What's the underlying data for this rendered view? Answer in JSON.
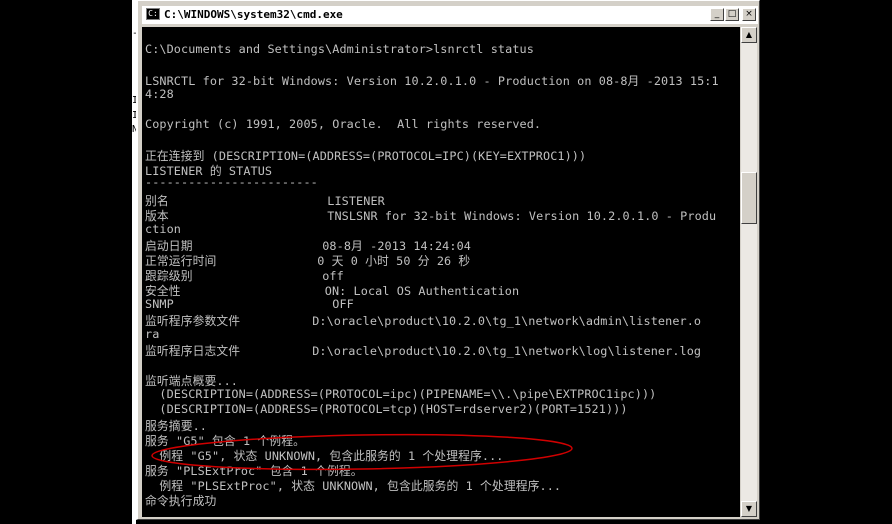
{
  "window": {
    "title": "C:\\WINDOWS\\system32\\cmd.exe",
    "controls": {
      "minimize": "_",
      "maximize": "□",
      "close": "×"
    }
  },
  "console": {
    "lines": [
      {
        "text": "C:\\Documents and Settings\\Administrator>lsnrctl status"
      },
      {
        "text": "LSNRCTL for 32-bit Windows: Version 10.2.0.1.0 - Production on 08-8月 -2013 15:1"
      },
      {
        "text": "4:28"
      },
      {
        "text": "Copyright (c) 1991, 2005, Oracle.  All rights reserved."
      },
      {
        "text": "正在连接到 (DESCRIPTION=(ADDRESS=(PROTOCOL=IPC)(KEY=EXTPROC1)))"
      },
      {
        "text": "LISTENER 的 STATUS"
      },
      {
        "text": "------------------------"
      },
      {
        "text": "别名                      LISTENER"
      },
      {
        "text": "版本                      TNSLSNR for 32-bit Windows: Version 10.2.0.1.0 - Produ"
      },
      {
        "text": "ction"
      },
      {
        "text": "启动日期                  08-8月 -2013 14:24:04"
      },
      {
        "text": "正常运行时间              0 天 0 小时 50 分 26 秒"
      },
      {
        "text": "跟踪级别                  off"
      },
      {
        "text": "安全性                    ON: Local OS Authentication"
      },
      {
        "text": "SNMP                      OFF"
      },
      {
        "text": "监听程序参数文件          D:\\oracle\\product\\10.2.0\\tg_1\\network\\admin\\listener.o"
      },
      {
        "text": "ra"
      },
      {
        "text": "监听程序日志文件          D:\\oracle\\product\\10.2.0\\tg_1\\network\\log\\listener.log"
      },
      {
        "text": "监听端点概要..."
      },
      {
        "text": "  (DESCRIPTION=(ADDRESS=(PROTOCOL=ipc)(PIPENAME=\\\\.\\pipe\\EXTPROC1ipc)))"
      },
      {
        "text": "  (DESCRIPTION=(ADDRESS=(PROTOCOL=tcp)(HOST=rdserver2)(PORT=1521)))"
      },
      {
        "text": "服务摘要.."
      },
      {
        "text": "服务 \"G5\" 包含 1 个例程。"
      },
      {
        "text": "  例程 \"G5\", 状态 UNKNOWN, 包含此服务的 1 个处理程序..."
      },
      {
        "text": "服务 \"PLSExtProc\" 包含 1 个例程。"
      },
      {
        "text": "  例程 \"PLSExtProc\", 状态 UNKNOWN, 包含此服务的 1 个处理程序..."
      },
      {
        "text": "命令执行成功"
      }
    ]
  },
  "background_fragments": [
    "-",
    "I",
    "I",
    "N"
  ],
  "colors": {
    "console_bg": "#000000",
    "console_text": "#c0c0c0",
    "annotation": "#d00000",
    "chrome": "#d4d0c8"
  },
  "icons": {
    "title_icon": "cmd-icon",
    "scroll_up": "scroll-up-arrow-icon",
    "scroll_down": "scroll-down-arrow-icon"
  }
}
